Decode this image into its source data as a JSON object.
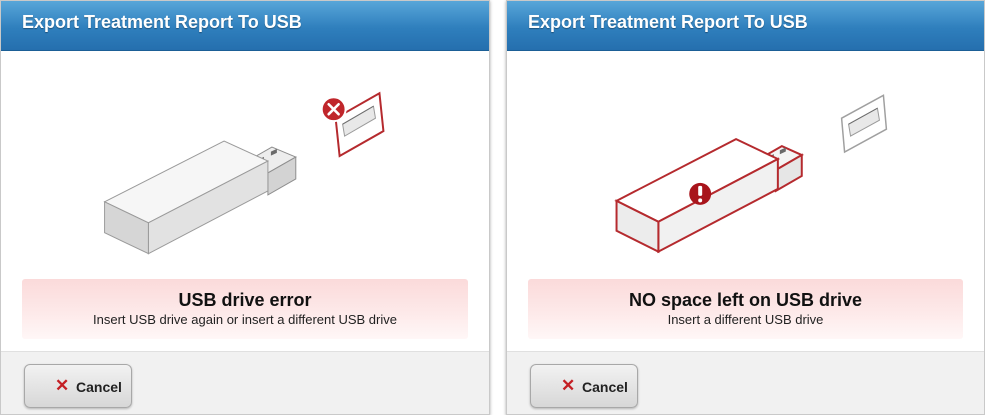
{
  "dialogs": [
    {
      "title": "Export Treatment Report To USB",
      "message_title": "USB drive error",
      "message_detail": "Insert USB drive again or insert a different USB drive",
      "cancel_label": "Cancel",
      "cancel_icon": "x-icon",
      "port_state": "error",
      "drive_state": "normal",
      "status_icon": "error-x-icon"
    },
    {
      "title": "Export Treatment Report To USB",
      "message_title": "NO space left on USB drive",
      "message_detail": "Insert a different USB drive",
      "cancel_label": "Cancel",
      "cancel_icon": "x-icon",
      "port_state": "normal",
      "drive_state": "error",
      "status_icon": "exclamation-icon"
    }
  ],
  "colors": {
    "title_bar": "#2f7fbd",
    "error_red": "#b52a2e",
    "message_background": "#fde9e9",
    "cancel_x": "#c41f24"
  }
}
